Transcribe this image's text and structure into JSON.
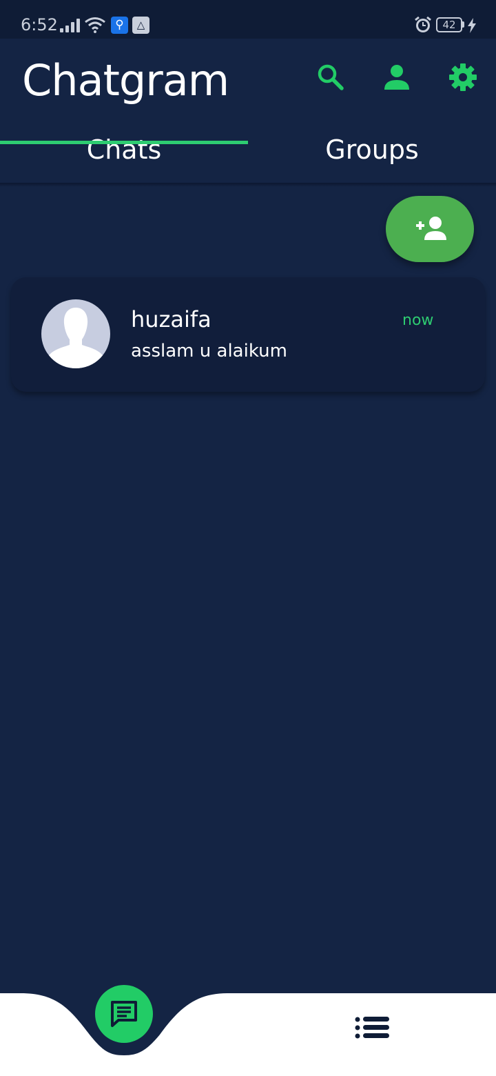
{
  "status_bar": {
    "time": "6:52",
    "battery_level": "42",
    "icons": [
      "signal-icon",
      "wifi-icon",
      "usb-icon",
      "drive-icon",
      "alarm-icon",
      "battery-icon",
      "charging-icon"
    ]
  },
  "app_bar": {
    "title": "Chatgram",
    "actions": [
      "search-icon",
      "profile-icon",
      "settings-icon"
    ]
  },
  "tabs": [
    {
      "label": "Chats",
      "selected": true
    },
    {
      "label": "Groups",
      "selected": false
    }
  ],
  "chats": [
    {
      "name": "huzaifa",
      "last_message": "asslam u alaikum",
      "time": "now"
    }
  ],
  "bottom_nav": {
    "items": [
      "chat-icon",
      "list-icon"
    ],
    "selected": "chat-icon"
  },
  "colors": {
    "background": "#142444",
    "status_bar": "#0f1c36",
    "accent": "#2ecc71",
    "fab": "#4caf50",
    "card": "#111e3b",
    "nav_bg": "#ffffff"
  }
}
